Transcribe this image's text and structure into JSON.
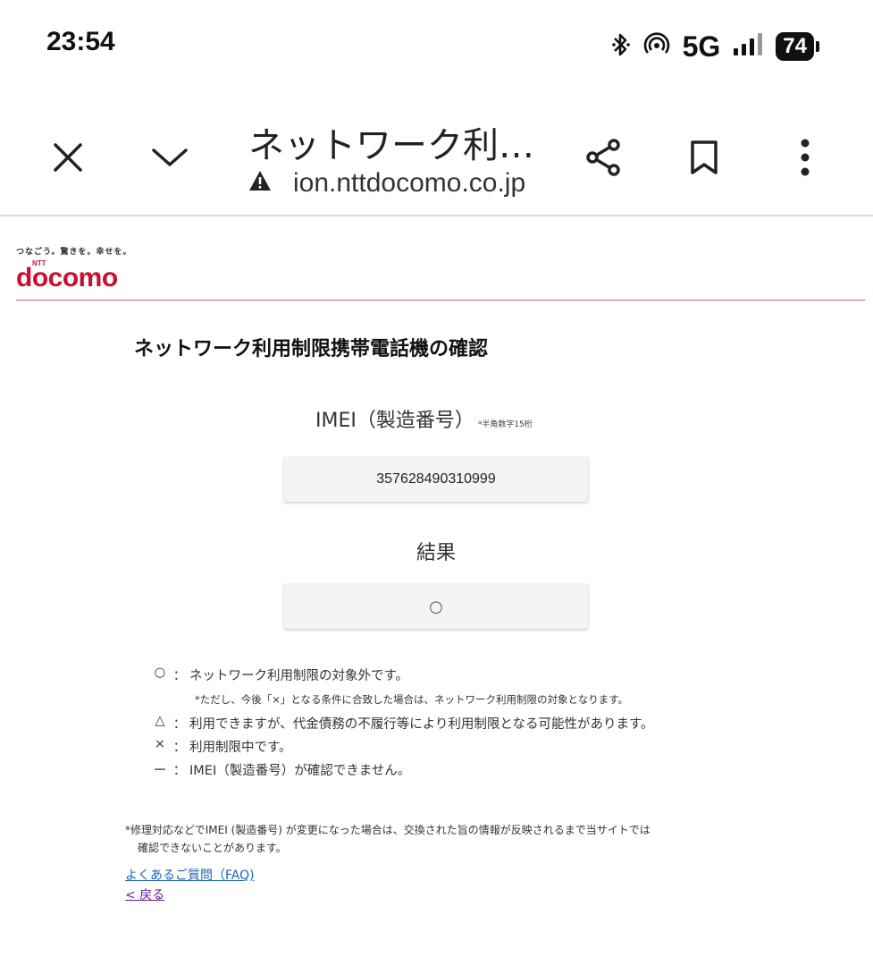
{
  "status_bar": {
    "time": "23:54",
    "network": "5G",
    "battery": "74",
    "icons": [
      "bluetooth-icon",
      "hotspot-icon",
      "signal-icon"
    ]
  },
  "toolbar": {
    "page_title": "ネットワーク利…",
    "url": "ion.nttdocomo.co.jp",
    "icons": [
      "close-icon",
      "chevron-down-icon",
      "warning-icon",
      "share-icon",
      "bookmark-icon",
      "more-vert-icon"
    ]
  },
  "header": {
    "tagline": "つなごう。驚きを。幸せを。",
    "logo_ntt": "NTT",
    "logo_text": "docomo",
    "brand_color": "#c8102e"
  },
  "main": {
    "heading": "ネットワーク利用制限携帯電話機の確認",
    "imei_label": "IMEI（製造番号）",
    "imei_note": "*半角数字15桁",
    "imei_value": "357628490310999",
    "result_label": "結果",
    "result_value": "○"
  },
  "legend": {
    "items": [
      {
        "symbol": "○",
        "colon": "：",
        "text": "ネットワーク利用制限の対象外です。"
      },
      {
        "symbol": "△",
        "colon": "：",
        "text": "利用できますが、代金債務の不履行等により利用制限となる可能性があります。"
      },
      {
        "symbol": "×",
        "colon": "：",
        "text": "利用制限中です。"
      },
      {
        "symbol": "ー",
        "colon": "：",
        "text": "IMEI（製造番号）が確認できません。"
      }
    ],
    "sub_note": "*ただし、今後「×」となる条件に合致した場合は、ネットワーク利用制限の対象となります。"
  },
  "footnote": {
    "line1": "*修理対応などでIMEI (製造番号) が変更になった場合は、交換された旨の情報が反映されるまで当サイトでは",
    "line2": "確認できないことがあります。"
  },
  "links": {
    "faq": "よくあるご質問（FAQ)",
    "back": "< 戻る"
  }
}
